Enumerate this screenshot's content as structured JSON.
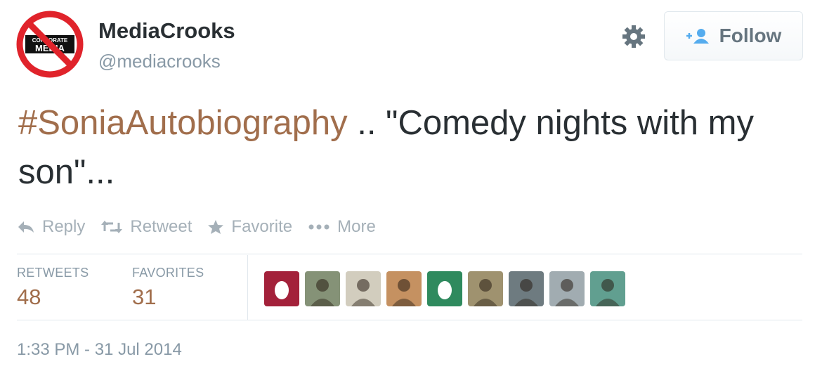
{
  "user": {
    "display_name": "MediaCrooks",
    "handle": "@mediacrooks",
    "avatar_text_top": "CORPORATE",
    "avatar_text_bottom": "MEDIA"
  },
  "follow_button": {
    "label": "Follow"
  },
  "tweet": {
    "hashtag": "#SoniaAutobiography",
    "text": " .. \"Comedy nights with my son\"..."
  },
  "actions": [
    {
      "label": "Reply",
      "icon": "reply-icon"
    },
    {
      "label": "Retweet",
      "icon": "retweet-icon"
    },
    {
      "label": "Favorite",
      "icon": "star-icon"
    },
    {
      "label": "More",
      "icon": "more-dots-icon"
    }
  ],
  "stats": {
    "retweets": {
      "label": "RETWEETS",
      "value": "48"
    },
    "favorites": {
      "label": "FAVORITES",
      "value": "31"
    }
  },
  "favoriters": [
    {
      "name": "egg-avatar",
      "color": "#a3213a"
    },
    {
      "name": "photo-avatar",
      "color": "#6b7b5a"
    },
    {
      "name": "photo-avatar",
      "color": "#c9c2b0"
    },
    {
      "name": "photo-avatar",
      "color": "#b9793f"
    },
    {
      "name": "egg-avatar",
      "color": "#2f8a5e"
    },
    {
      "name": "photo-avatar",
      "color": "#8a7a50"
    },
    {
      "name": "photo-avatar",
      "color": "#4f5e64"
    },
    {
      "name": "photo-avatar",
      "color": "#8d9aa0"
    },
    {
      "name": "photo-avatar",
      "color": "#3f8a78"
    }
  ],
  "timestamp": "1:33 PM - 31 Jul 2014",
  "colors": {
    "link": "#a16e4c",
    "muted": "#8899a6",
    "border": "#e1e8ed",
    "no_sign": "#e0232b"
  }
}
